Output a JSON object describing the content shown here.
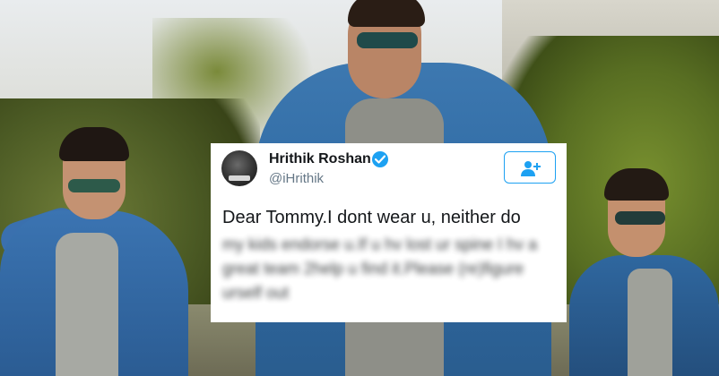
{
  "tweet": {
    "display_name": "Hrithik Roshan",
    "handle": "@iHrithik",
    "text_visible": "Dear Tommy.I dont wear u, neither do",
    "text_blurred": "my kids endorse u.If u hv lost ur spine I hv a great team 2help u find it.Please (re)figure urself out",
    "verified_icon": "verified-badge",
    "follow_icon": "follow-person-plus",
    "colors": {
      "accent": "#1da1f2",
      "name": "#14171a",
      "handle": "#657786"
    }
  }
}
